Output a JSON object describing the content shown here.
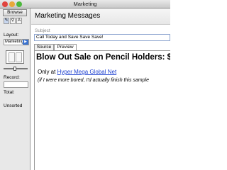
{
  "window": {
    "title": "Marketing"
  },
  "sidebar": {
    "mode_tab": "Browse",
    "tools": [
      "✎",
      "⚲",
      "A"
    ],
    "layout_label": "Layout:",
    "layout_value": "Marketing",
    "record_label": "Record:",
    "total_label": "Total:",
    "sort_status": "Unsorted"
  },
  "main": {
    "title": "Marketing Messages",
    "subject_label": "Subject",
    "subject_value": "Call Today and Save Save Save!",
    "tabs": [
      "Source",
      "Preview"
    ],
    "active_tab": "Preview",
    "preview": {
      "headline": "Blow Out Sale on Pencil Holders: $",
      "only_at": "Only at ",
      "link_text": "Hyper Mega Global Net",
      "note": "(if I were more bored, I'd actually finish this sample"
    }
  },
  "colors": {
    "close": "#e0443e",
    "minimize": "#e8a83a",
    "zoom": "#4cb83c",
    "link": "#1c3fd0",
    "accent": "#3b73d0"
  }
}
